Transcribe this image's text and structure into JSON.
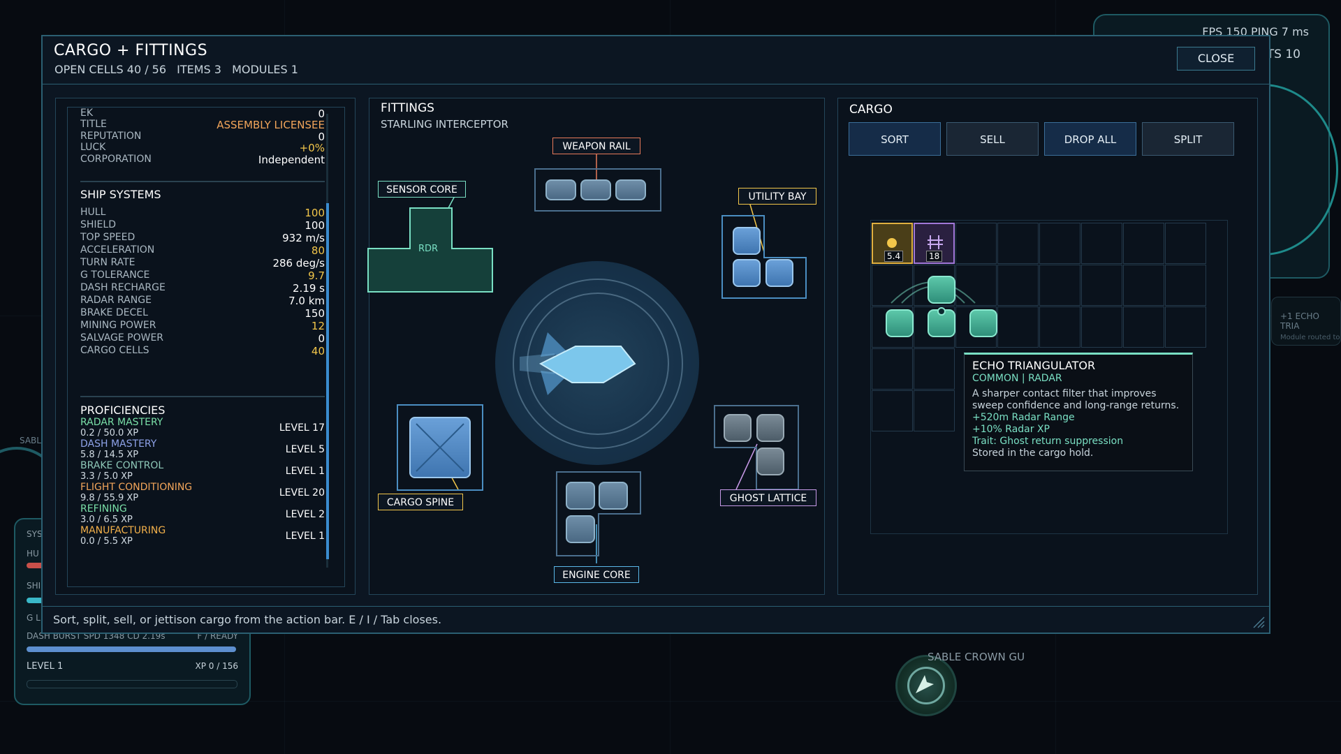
{
  "hud": {
    "fps": "FPS 150   PING 7 ms",
    "ts": "TS 10",
    "mini_title": "+1 ECHO TRIA",
    "mini_sub": "Module routed to",
    "sable_left": "SABL",
    "sys_labels": [
      "SYS",
      "HU",
      "SHI",
      "G L"
    ],
    "dash_line": "DASH BURST   SPD 1348   CD 2.19s",
    "dash_ready": "F / READY",
    "level": "LEVEL 1",
    "xp": "XP 0 / 156",
    "sable_crown": "SABLE CROWN GU"
  },
  "window": {
    "title": "CARGO + FITTINGS",
    "sub": [
      "OPEN CELLS 40 / 56",
      "ITEMS 3",
      "MODULES 1"
    ],
    "close": "CLOSE",
    "footer": "Sort, split, sell, or jettison cargo from the action bar. E / I / Tab closes."
  },
  "stats": {
    "top": [
      {
        "k": "EK",
        "v": "0"
      },
      {
        "k": "TITLE",
        "v": "ASSEMBLY LICENSEE",
        "c": "org"
      },
      {
        "k": "REPUTATION",
        "v": "0"
      },
      {
        "k": "LUCK",
        "v": "+0%",
        "c": "yel"
      },
      {
        "k": "CORPORATION",
        "v": "Independent"
      }
    ],
    "ship_title": "SHIP SYSTEMS",
    "ship": [
      {
        "k": "HULL",
        "v": "100",
        "c": "yel"
      },
      {
        "k": "SHIELD",
        "v": "100"
      },
      {
        "k": "TOP SPEED",
        "v": "932 m/s"
      },
      {
        "k": "ACCELERATION",
        "v": "80",
        "c": "yel"
      },
      {
        "k": "TURN RATE",
        "v": "286 deg/s"
      },
      {
        "k": "G TOLERANCE",
        "v": "9.7",
        "c": "yel"
      },
      {
        "k": "DASH RECHARGE",
        "v": "2.19 s"
      },
      {
        "k": "RADAR RANGE",
        "v": "7.0 km"
      },
      {
        "k": "BRAKE DECEL",
        "v": "150"
      },
      {
        "k": "MINING POWER",
        "v": "12",
        "c": "yel"
      },
      {
        "k": "SALVAGE POWER",
        "v": "0"
      },
      {
        "k": "CARGO CELLS",
        "v": "40",
        "c": "yel"
      }
    ],
    "prof_title": "PROFICIENCIES",
    "profs": [
      {
        "n": "RADAR MASTERY",
        "xp": "0.2 / 50.0 XP",
        "lv": "LEVEL 17",
        "color": "#7ae0a8"
      },
      {
        "n": "DASH MASTERY",
        "xp": "5.8 / 14.5 XP",
        "lv": "LEVEL 5",
        "color": "#8ea2e8"
      },
      {
        "n": "BRAKE CONTROL",
        "xp": "3.3 / 5.0 XP",
        "lv": "LEVEL 1",
        "color": "#8ec8b8"
      },
      {
        "n": "FLIGHT CONDITIONING",
        "xp": "9.8 / 55.9 XP",
        "lv": "LEVEL 20",
        "color": "#f2a55a"
      },
      {
        "n": "REFINING",
        "xp": "3.0 / 6.5 XP",
        "lv": "LEVEL 2",
        "color": "#7ae0a8"
      },
      {
        "n": "MANUFACTURING",
        "xp": "0.0 / 5.5 XP",
        "lv": "LEVEL 1",
        "color": "#f2b04a"
      }
    ]
  },
  "fittings": {
    "title": "FITTINGS",
    "ship": "STARLING INTERCEPTOR",
    "slots": {
      "weapon": "WEAPON RAIL",
      "sensor": "SENSOR CORE",
      "utility": "UTILITY BAY",
      "cargo": "CARGO SPINE",
      "ghost": "GHOST LATTICE",
      "engine": "ENGINE CORE"
    },
    "sensor_tag": "RDR",
    "colors": {
      "weapon": "#e87a5a",
      "sensor": "#7ae0c4",
      "utility": "#f2c64a",
      "cargo": "#f2c64a",
      "ghost": "#c89ae8",
      "engine": "#5ab8e8"
    }
  },
  "cargo": {
    "title": "CARGO",
    "buttons": [
      "SORT",
      "SELL",
      "DROP ALL",
      "SPLIT"
    ],
    "item1_qty": "5.4",
    "item2_qty": "18",
    "tooltip": {
      "title": "ECHO TRIANGULATOR",
      "rarity": "COMMON   |   RADAR",
      "desc": "A sharper contact filter that improves sweep confidence and long-range returns.",
      "bonus1": "+520m Radar Range",
      "bonus2": "+10% Radar XP",
      "trait": "Trait: Ghost return suppression",
      "stored": "Stored in the cargo hold."
    }
  }
}
